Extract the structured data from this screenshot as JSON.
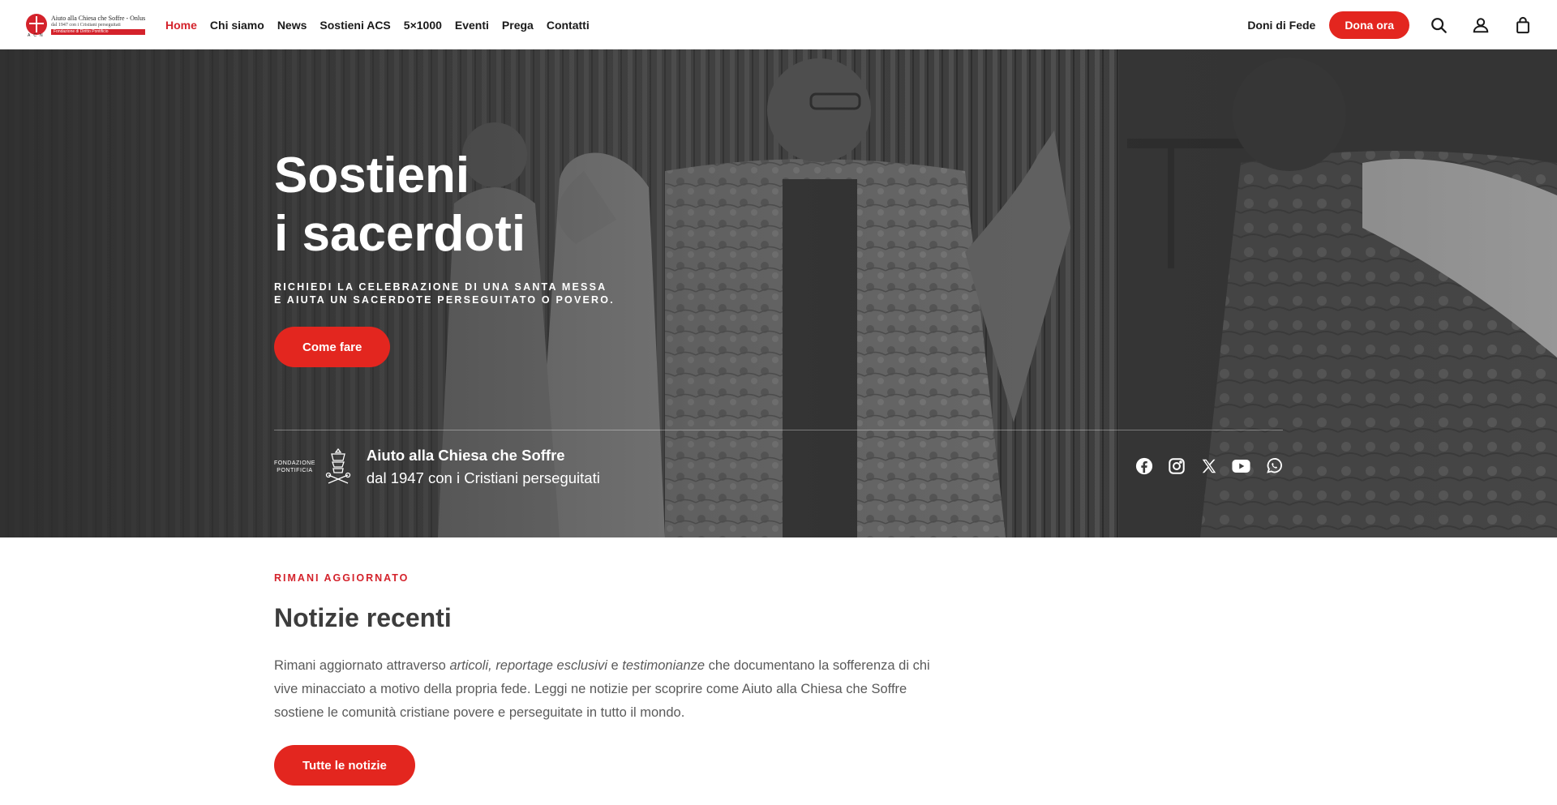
{
  "logo": {
    "line1": "Aiuto alla Chiesa che Soffre - Onlus",
    "line2": "dal 1947 con i Cristiani perseguitati",
    "bar": "Fondazione di Diritto Pontificio",
    "acn": "ACN"
  },
  "nav": {
    "items": [
      {
        "label": "Home",
        "active": true
      },
      {
        "label": "Chi siamo"
      },
      {
        "label": "News"
      },
      {
        "label": "Sostieni ACS"
      },
      {
        "label": "5×1000"
      },
      {
        "label": "Eventi"
      },
      {
        "label": "Prega"
      },
      {
        "label": "Contatti"
      }
    ]
  },
  "header": {
    "doni_label": "Doni di Fede",
    "donate_label": "Dona ora",
    "icons": [
      "search-icon",
      "account-icon",
      "cart-icon"
    ]
  },
  "hero": {
    "title_line1": "Sostieni",
    "title_line2": "i sacerdoti",
    "subtitle_line1": "RICHIEDI LA CELEBRAZIONE DI UNA SANTA MESSA",
    "subtitle_line2": "E AIUTA UN SACERDOTE PERSEGUITATO O POVERO.",
    "cta_label": "Come fare",
    "fund_small_line1": "FONDAZIONE",
    "fund_small_line2": "PONTIFICIA",
    "fund_name": "Aiuto alla Chiesa che Soffre",
    "fund_since": "dal 1947 con i Cristiani perseguitati",
    "socials": [
      "facebook-icon",
      "instagram-icon",
      "x-icon",
      "youtube-icon",
      "whatsapp-icon"
    ]
  },
  "news": {
    "eyebrow": "RIMANI AGGIORNATO",
    "title": "Notizie recenti",
    "body_1": "Rimani aggiornato attraverso ",
    "body_em1": "articoli",
    "body_2": ", ",
    "body_em2": "reportage esclusivi",
    "body_3": " e ",
    "body_em3": "testimonianze",
    "body_4": " che documentano la sofferenza di chi vive minacciato a motivo della propria fede. Leggi ne notizie per scoprire come Aiuto alla Chiesa che Soffre sostiene le comunità cristiane povere e perseguitate in tutto il mondo.",
    "cta_label": "Tutte le notizie"
  },
  "colors": {
    "accent": "#e3261f",
    "brand_red": "#d4222b",
    "hero_bg": "#3d3d3d"
  }
}
